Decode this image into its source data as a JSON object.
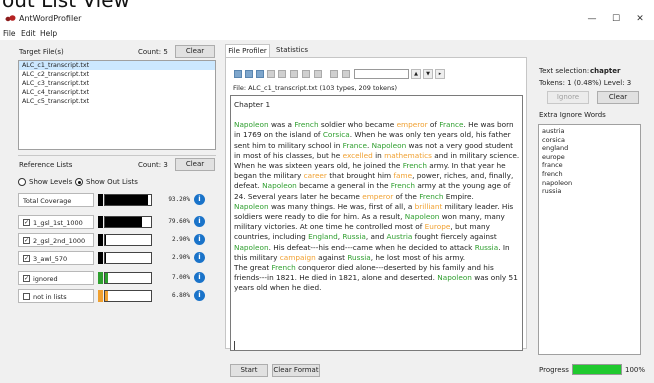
{
  "banner": {
    "text": "out List View"
  },
  "window": {
    "title": "AntWordProfiler",
    "minimize": "—",
    "maximize": "☐",
    "close": "✕"
  },
  "menu": [
    "File",
    "Edit",
    "Help"
  ],
  "left": {
    "target_files_label": "Target File(s)",
    "count_label": "Count: 5",
    "clear_label": "Clear",
    "files": [
      "ALC_c1_transcript.txt",
      "ALC_c2_transcript.txt",
      "ALC_c3_transcript.txt",
      "ALC_c4_transcript.txt",
      "ALC_c5_transcript.txt"
    ],
    "reference_lists_label": "Reference Lists",
    "ref_count_label": "Count: 3",
    "ref_clear_label": "Clear",
    "show_levels": "Show Levels",
    "show_out_lists": "Show Out Lists",
    "rows": [
      {
        "label": "Total Coverage",
        "checkbox": false,
        "checked": false,
        "swatch": "#000000",
        "fill": 0.932,
        "fill_color": "#000000",
        "pct": "93.20%"
      },
      {
        "label": "1_gsl_1st_1000",
        "checkbox": true,
        "checked": true,
        "swatch": "#000000",
        "fill": 0.796,
        "fill_color": "#000000",
        "pct": "79.60%"
      },
      {
        "label": "2_gsl_2nd_1000",
        "checkbox": true,
        "checked": true,
        "swatch": "#000000",
        "fill": 0.029,
        "fill_color": "#000000",
        "pct": "2.90%"
      },
      {
        "label": "3_awl_570",
        "checkbox": true,
        "checked": true,
        "swatch": "#000000",
        "fill": 0.029,
        "fill_color": "#000000",
        "pct": "2.90%"
      },
      {
        "label": "ignored",
        "checkbox": true,
        "checked": true,
        "swatch": "#2e9e2e",
        "fill": 0.07,
        "fill_color": "#2e9e2e",
        "pct": "7.00%"
      },
      {
        "label": "not in lists",
        "checkbox": true,
        "checked": false,
        "swatch": "#f0a030",
        "fill": 0.068,
        "fill_color": "#f0a030",
        "pct": "6.80%"
      }
    ],
    "info_glyph": "i"
  },
  "middle": {
    "tabs": [
      "File Profiler",
      "Statistics"
    ],
    "file_info": "File:  ALC_c1_transcript.txt    (103 types, 209 tokens)",
    "heading": "Chapter 1",
    "paragraphs": [
      [
        [
          "g",
          "Napoleon"
        ],
        [
          "n",
          " was a "
        ],
        [
          "g",
          "French"
        ],
        [
          "n",
          " soldier who became "
        ],
        [
          "o",
          "emperor"
        ],
        [
          "n",
          " of "
        ],
        [
          "g",
          "France"
        ],
        [
          "n",
          ". He was born in 1769 on the island of "
        ],
        [
          "g",
          "Corsica"
        ],
        [
          "n",
          ". When he was only ten years old, his father sent him to military school in "
        ],
        [
          "g",
          "France"
        ],
        [
          "n",
          ". "
        ],
        [
          "g",
          "Napoleon"
        ],
        [
          "n",
          " was not a very good student in most of his classes, but he "
        ],
        [
          "o",
          "excelled"
        ],
        [
          "n",
          " in "
        ],
        [
          "o",
          "mathematics"
        ],
        [
          "n",
          " and in military science. When he was sixteen years old, he joined the "
        ],
        [
          "g",
          "French"
        ],
        [
          "n",
          " army. In that year he began the military "
        ],
        [
          "o",
          "career"
        ],
        [
          "n",
          " that brought him "
        ],
        [
          "o",
          "fame"
        ],
        [
          "n",
          ", power, riches, and, finally, defeat. "
        ],
        [
          "g",
          "Napoleon"
        ],
        [
          "n",
          " became a general in the "
        ],
        [
          "g",
          "French"
        ],
        [
          "n",
          " army at the young age of 24. Several years later he became "
        ],
        [
          "o",
          "emperor"
        ],
        [
          "n",
          " of the "
        ],
        [
          "g",
          "French"
        ],
        [
          "n",
          " Empire."
        ]
      ],
      [
        [
          "n",
          "   "
        ],
        [
          "g",
          "Napoleon"
        ],
        [
          "n",
          " was many things. He was, first of all, a "
        ],
        [
          "o",
          "brilliant"
        ],
        [
          "n",
          " military leader. His soldiers were ready to die for him. As a result, "
        ],
        [
          "g",
          "Napoleon"
        ],
        [
          "n",
          " won many, many military victories. At one time he controlled most of "
        ],
        [
          "o",
          "Europe"
        ],
        [
          "n",
          ", but many countries, including "
        ],
        [
          "g",
          "England"
        ],
        [
          "n",
          ", "
        ],
        [
          "g",
          "Russia"
        ],
        [
          "n",
          ", and "
        ],
        [
          "g",
          "Austria"
        ],
        [
          "n",
          " fought fiercely against "
        ],
        [
          "g",
          "Napoleon"
        ],
        [
          "n",
          ". His defeat---his end---came when he decided to attack "
        ],
        [
          "g",
          "Russia"
        ],
        [
          "n",
          ". In this military "
        ],
        [
          "o",
          "campaign"
        ],
        [
          "n",
          " against "
        ],
        [
          "g",
          "Russia"
        ],
        [
          "n",
          ", he lost most of his army."
        ]
      ],
      [
        [
          "n",
          "   The great "
        ],
        [
          "g",
          "French"
        ],
        [
          "n",
          " conqueror died alone---deserted by his family and his friends---in 1821. He died in 1821, alone and deserted. "
        ],
        [
          "g",
          "Napoleon"
        ],
        [
          "n",
          " was only 51 years old when he died."
        ]
      ]
    ],
    "start_label": "Start",
    "clear_format_label": "Clear Format"
  },
  "right": {
    "text_selection_label": "Text selection:",
    "text_selection_value": "chapter",
    "tokens_label": "Tokens: 1 (0.48%)  Level: 3",
    "ignore_label": "Ignore",
    "clear_label": "Clear",
    "extra_ignore_label": "Extra Ignore Words",
    "ignore_words": [
      "austria",
      "corsica",
      "england",
      "europe",
      "france",
      "french",
      "napoleon",
      "russia"
    ],
    "progress_label": "Progress",
    "progress_value": 1.0,
    "progress_pct": "100%"
  }
}
